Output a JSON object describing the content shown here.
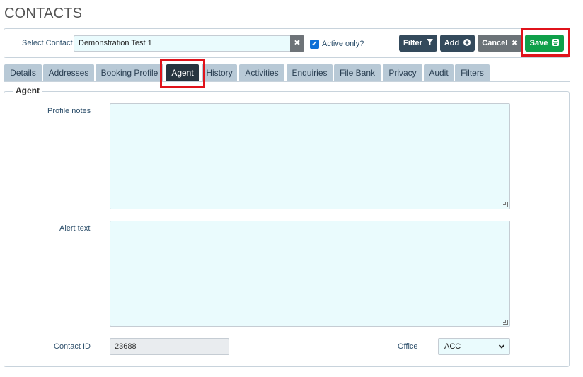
{
  "page": {
    "title": "CONTACTS"
  },
  "toolbar": {
    "select_contact_label": "Select Contact",
    "contact_value": "Demonstration Test 1",
    "active_only_label": "Active only?",
    "active_only_checked": true,
    "filter_label": "Filter",
    "add_label": "Add",
    "cancel_label": "Cancel",
    "save_label": "Save",
    "icons": {
      "clear": "×",
      "filter": "funnel-icon",
      "add": "plus-circle-icon",
      "cancel": "close-icon",
      "save": "floppy-disk-icon"
    }
  },
  "tabs": [
    {
      "label": "Details"
    },
    {
      "label": "Addresses"
    },
    {
      "label": "Booking Profile"
    },
    {
      "label": "Agent",
      "active": true
    },
    {
      "label": "History"
    },
    {
      "label": "Activities"
    },
    {
      "label": "Enquiries"
    },
    {
      "label": "File Bank"
    },
    {
      "label": "Privacy"
    },
    {
      "label": "Audit"
    },
    {
      "label": "Filters"
    }
  ],
  "agent": {
    "legend": "Agent",
    "profile_notes_label": "Profile notes",
    "profile_notes_value": "",
    "alert_text_label": "Alert text",
    "alert_text_value": "",
    "contact_id_label": "Contact ID",
    "contact_id_value": "23688",
    "office_label": "Office",
    "office_value": "ACC"
  },
  "colors": {
    "highlight": "#e0131b",
    "save_button": "#0fa04a",
    "dark_button": "#344a5c",
    "active_tab": "#26343f",
    "inactive_tab": "#b8c9d6",
    "input_background": "#eafbfd"
  }
}
